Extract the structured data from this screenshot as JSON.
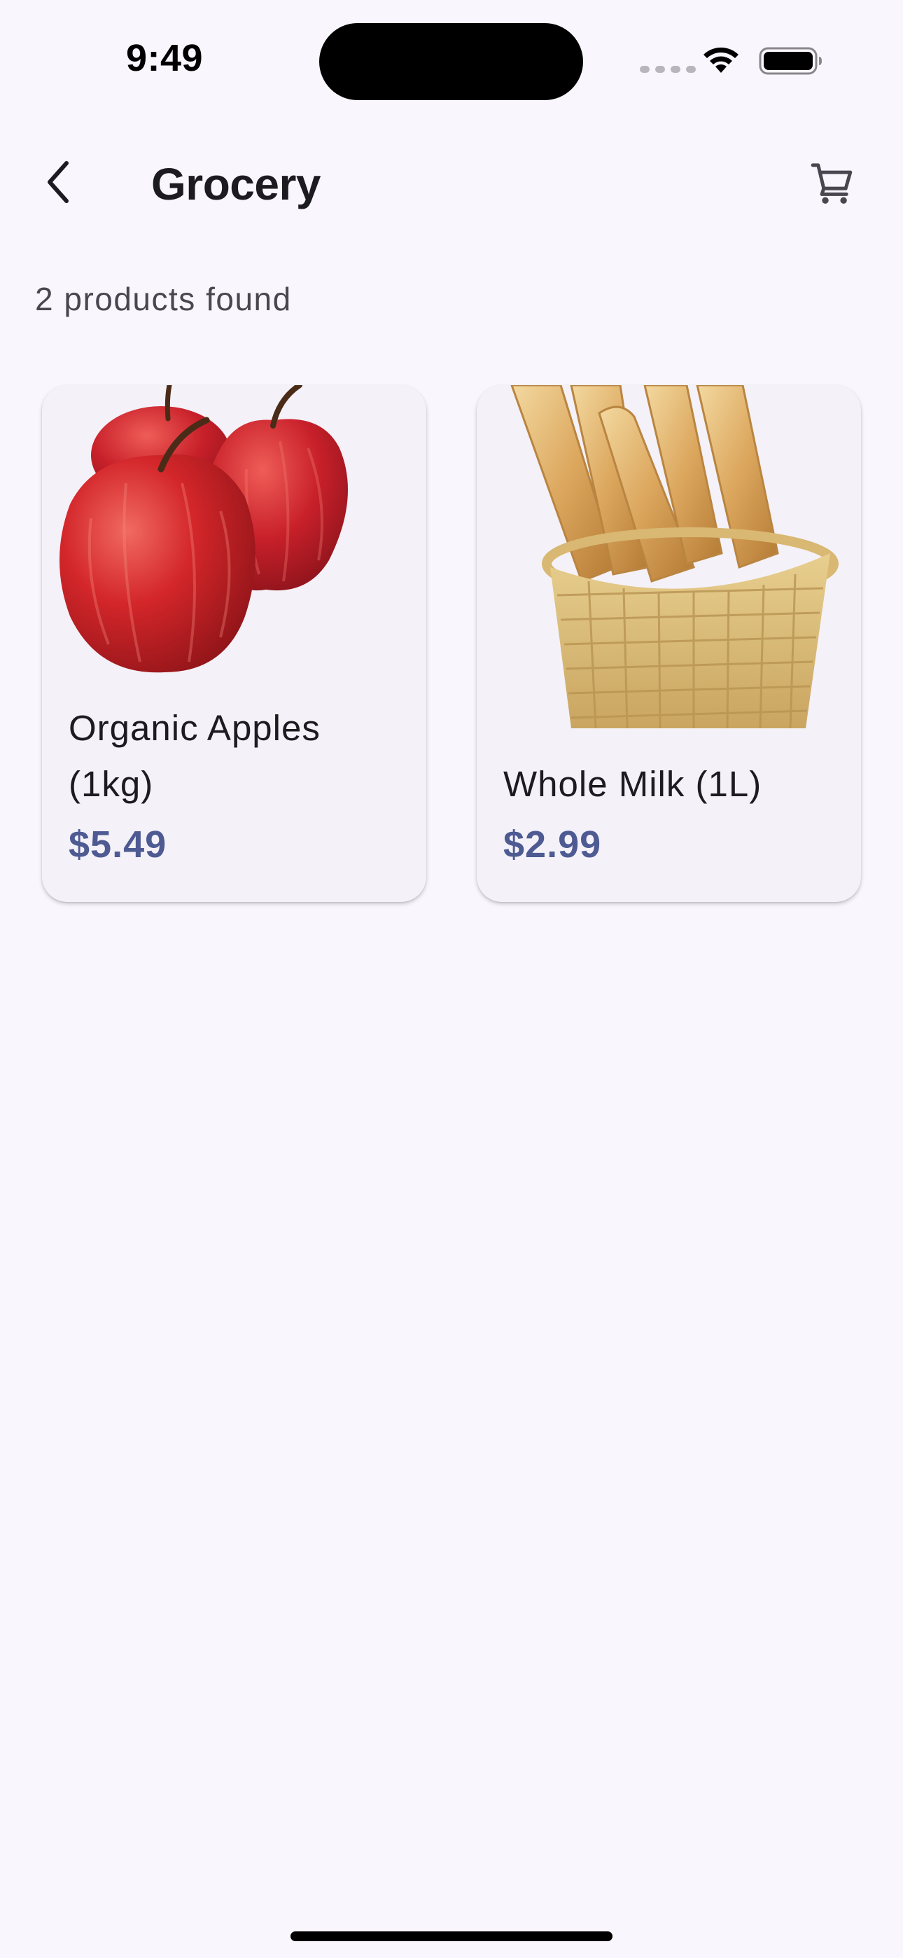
{
  "status_bar": {
    "time": "9:49"
  },
  "app_bar": {
    "title": "Grocery",
    "back_icon": "chevron-left-icon",
    "cart_icon": "shopping-cart-icon"
  },
  "results": {
    "count_label": "2 products found"
  },
  "products": [
    {
      "name": "Organic Apples (1kg)",
      "price": "$5.49",
      "image": "red-apples"
    },
    {
      "name": "Whole Milk (1L)",
      "price": "$2.99",
      "image": "bread-basket"
    }
  ],
  "colors": {
    "background": "#f9f6fd",
    "card": "#f4f1f8",
    "price": "#4e5a92",
    "text": "#1c1b20"
  }
}
